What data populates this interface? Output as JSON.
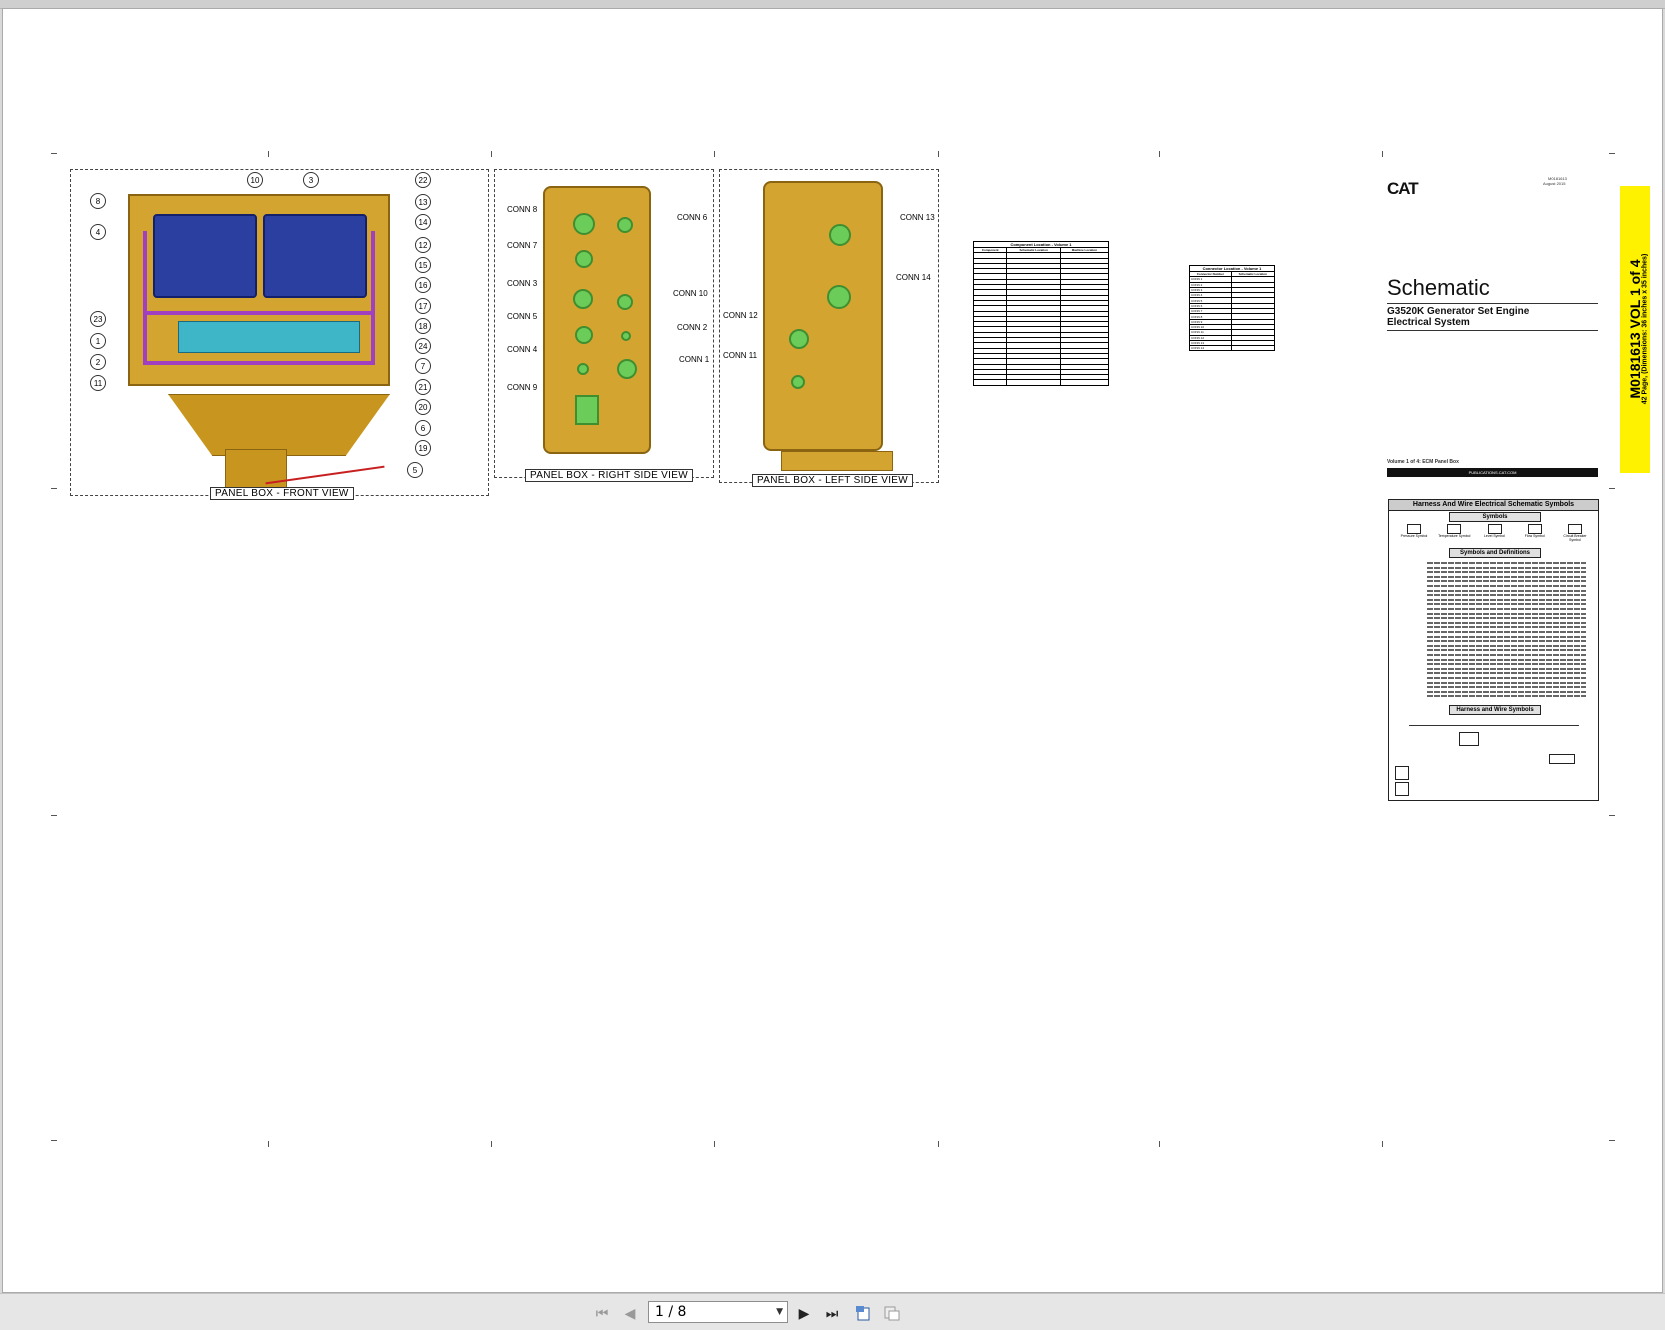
{
  "viewer": {
    "page_indicator": "1 / 8",
    "buttons": {
      "first": "⏮",
      "prev": "◀",
      "next": "▶",
      "last": "⏭"
    }
  },
  "drawing": {
    "front_view": {
      "label": "PANEL BOX - FRONT VIEW",
      "callouts": [
        "10",
        "3",
        "22",
        "8",
        "13",
        "4",
        "14",
        "12",
        "15",
        "16",
        "23",
        "17",
        "18",
        "1",
        "24",
        "2",
        "7",
        "11",
        "21",
        "20",
        "6",
        "19",
        "5"
      ]
    },
    "right_view": {
      "label": "PANEL BOX - RIGHT SIDE VIEW",
      "connectors": [
        "CONN 8",
        "CONN 6",
        "CONN 7",
        "CONN 3",
        "CONN 10",
        "CONN 5",
        "CONN 2",
        "CONN 4",
        "CONN 1",
        "CONN 9"
      ]
    },
    "left_view": {
      "label": "PANEL BOX - LEFT SIDE VIEW",
      "connectors": [
        "CONN 13",
        "CONN 14",
        "CONN 12",
        "CONN 11"
      ]
    }
  },
  "tables": {
    "component_location": {
      "caption": "Component Location - Volume 1",
      "headers": [
        "Component",
        "Schematic Location",
        "Machine Location"
      ]
    },
    "connector_location": {
      "caption": "Connector Location - Volume 1",
      "headers": [
        "Connector Number",
        "Schematic Location"
      ],
      "rows": [
        "CONN 1",
        "CONN 2",
        "CONN 3",
        "CONN 4",
        "CONN 5",
        "CONN 6",
        "CONN 7",
        "CONN 8",
        "CONN 9",
        "CONN 10",
        "CONN 11",
        "CONN 12",
        "CONN 13",
        "CONN 14"
      ]
    }
  },
  "title_block": {
    "brand": "CAT",
    "doc_number": "M0181613",
    "date": "August 2015",
    "title": "Schematic",
    "subtitle_line1": "G3520K Generator Set Engine",
    "subtitle_line2": "Electrical System",
    "volume_note": "Volume 1 of 4: ECM Panel Box",
    "web": "PUBLICATIONS.CAT.COM",
    "side_band_main": "M0181613 VOL 1 of 4",
    "side_band_sub": "42 Page, (Dimensions: 36 inches x 35 inches)"
  },
  "legend": {
    "title": "Harness And Wire Electrical Schematic Symbols",
    "symbols_header": "Symbols",
    "definitions_header": "Symbols and Definitions",
    "harness_header": "Harness and Wire Symbols",
    "symbol_names": [
      "Pressure Symbol",
      "Temperature Symbol",
      "Level Symbol",
      "Flow Symbol",
      "Circuit Breaker Symbol"
    ]
  },
  "colors": {
    "panel_yellow": "#d4a431",
    "connector_green": "#6ccc5a",
    "ecm_blue": "#2a3fa0",
    "wire_purple": "#a040c0",
    "band_yellow": "#fff200"
  }
}
